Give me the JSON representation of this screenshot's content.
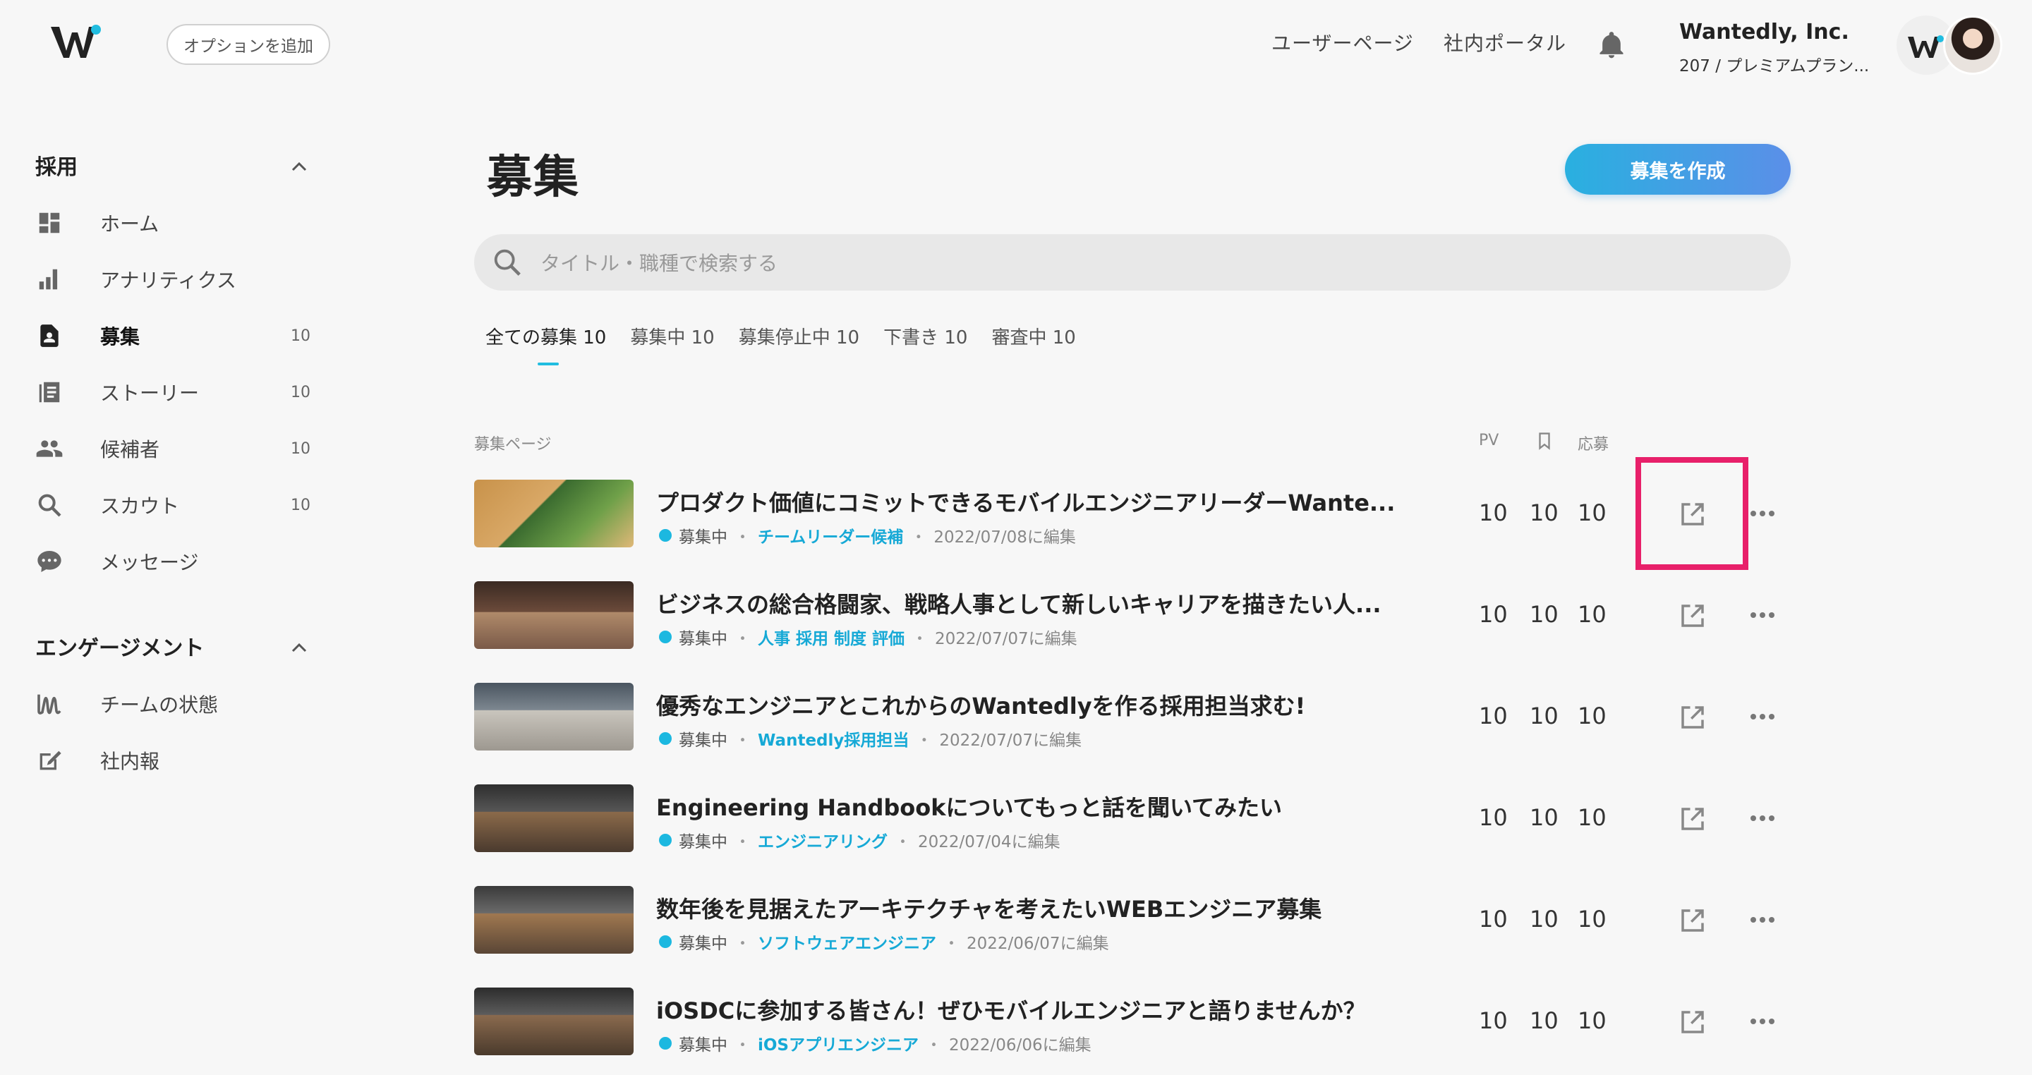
{
  "header": {
    "add_option": "オプションを追加",
    "user_page": "ユーザーページ",
    "portal": "社内ポータル",
    "org_name": "Wantedly, Inc.",
    "org_plan": "207 / プレミアムプラン..."
  },
  "sidebar": {
    "recruit_title": "採用",
    "engage_title": "エンゲージメント",
    "recruit_items": [
      {
        "label": "ホーム",
        "count": ""
      },
      {
        "label": "アナリティクス",
        "count": ""
      },
      {
        "label": "募集",
        "count": "10"
      },
      {
        "label": "ストーリー",
        "count": "10"
      },
      {
        "label": "候補者",
        "count": "10"
      },
      {
        "label": "スカウト",
        "count": "10"
      },
      {
        "label": "メッセージ",
        "count": ""
      }
    ],
    "engage_items": [
      {
        "label": "チームの状態"
      },
      {
        "label": "社内報"
      }
    ]
  },
  "main": {
    "title": "募集",
    "create_button": "募集を作成",
    "search_placeholder": "タイトル・職種で検索する",
    "tabs": [
      "全ての募集 10",
      "募集中 10",
      "募集停止中 10",
      "下書き 10",
      "審査中 10"
    ],
    "columns": {
      "page": "募集ページ",
      "pv": "PV",
      "apply": "応募"
    },
    "rows": [
      {
        "title": "プロダクト価値にコミットできるモバイルエンジニアリーダーWante...",
        "status": "募集中",
        "tag": "チームリーダー候補",
        "date": "2022/07/08に編集",
        "pv": "10",
        "bookmark": "10",
        "apply": "10"
      },
      {
        "title": "ビジネスの総合格闘家、戦略人事として新しいキャリアを描きたい人...",
        "status": "募集中",
        "tag": "人事 採用 制度 評価",
        "date": "2022/07/07に編集",
        "pv": "10",
        "bookmark": "10",
        "apply": "10"
      },
      {
        "title": "優秀なエンジニアとこれからのWantedlyを作る採用担当求む!",
        "status": "募集中",
        "tag": "Wantedly採用担当",
        "date": "2022/07/07に編集",
        "pv": "10",
        "bookmark": "10",
        "apply": "10"
      },
      {
        "title": "Engineering Handbookについてもっと話を聞いてみたい",
        "status": "募集中",
        "tag": "エンジニアリング",
        "date": "2022/07/04に編集",
        "pv": "10",
        "bookmark": "10",
        "apply": "10"
      },
      {
        "title": "数年後を見据えたアーキテクチャを考えたいWEBエンジニア募集",
        "status": "募集中",
        "tag": "ソフトウェアエンジニア",
        "date": "2022/06/07に編集",
        "pv": "10",
        "bookmark": "10",
        "apply": "10"
      },
      {
        "title": "iOSDCに参加する皆さん！ぜひモバイルエンジニアと語りませんか？",
        "status": "募集中",
        "tag": "iOSアプリエンジニア",
        "date": "2022/06/06に編集",
        "pv": "10",
        "bookmark": "10",
        "apply": "10"
      }
    ]
  },
  "colors": {
    "accent": "#21bde0",
    "highlight": "#e8206a",
    "button_start": "#29b0e0",
    "button_end": "#5b8fe8"
  }
}
